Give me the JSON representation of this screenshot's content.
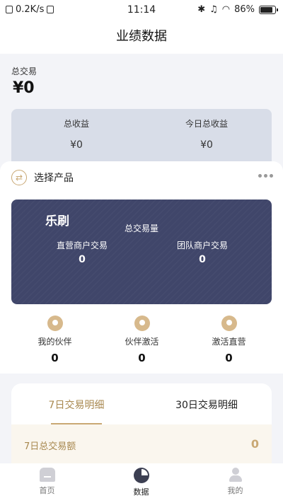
{
  "statusbar": {
    "speed": "0.2K/s",
    "time": "11:14",
    "battery": "86%"
  },
  "header": {
    "title": "业绩数据"
  },
  "summary": {
    "total_label": "总交易",
    "total_value": "¥0",
    "income": [
      {
        "label": "总收益",
        "value": "¥0"
      },
      {
        "label": "今日总收益",
        "value": "¥0"
      }
    ]
  },
  "product": {
    "select_label": "选择产品"
  },
  "card": {
    "brand": "乐刷",
    "title": "总交易量",
    "cols": [
      {
        "label": "直营商户交易",
        "value": "0"
      },
      {
        "label": "团队商户交易",
        "value": "0"
      }
    ]
  },
  "quick": [
    {
      "label": "我的伙伴",
      "value": "0",
      "icon": "partner-icon"
    },
    {
      "label": "伙伴激活",
      "value": "0",
      "icon": "activate-icon"
    },
    {
      "label": "激活直营",
      "value": "0",
      "icon": "direct-icon"
    }
  ],
  "detail": {
    "tabs": [
      {
        "label": "7日交易明细"
      },
      {
        "label": "30日交易明细"
      }
    ],
    "sum_label": "7日总交易额",
    "sum_value": "0"
  },
  "nav": [
    {
      "label": "首页",
      "icon": "home-icon"
    },
    {
      "label": "数据",
      "icon": "chart-icon"
    },
    {
      "label": "我的",
      "icon": "user-icon"
    }
  ],
  "colors": {
    "gold": "#c9a874",
    "navy": "#40466a"
  }
}
